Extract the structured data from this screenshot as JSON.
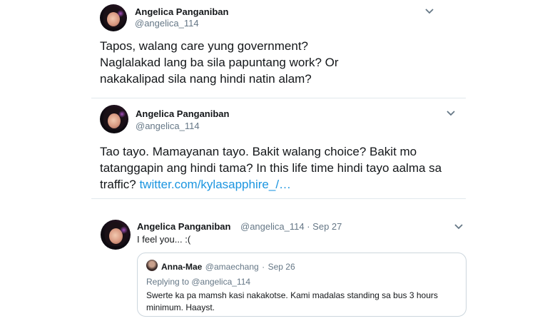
{
  "tweet1": {
    "name": "Angelica Panganiban",
    "handle": "@angelica_114",
    "text": "Tapos, walang care yung government? Naglalakad lang ba sila papuntang work? Or nakakalipad sila nang hindi natin alam?",
    "menu_icon": "chevron-down-icon"
  },
  "tweet2": {
    "name": "Angelica Panganiban",
    "handle": "@angelica_114",
    "text": "Tao tayo. Mamayanan tayo. Bakit walang choice? Bakit mo tatanggapin ang hindi tama? In this life time hindi tayo aalma sa traffic?",
    "link": "twitter.com/kylasapphire_/…",
    "menu_icon": "chevron-down-icon"
  },
  "tweet3": {
    "name": "Angelica Panganiban",
    "handle": "@angelica_114",
    "dot": "·",
    "date": "Sep 27",
    "text": "I feel you... :(",
    "menu_icon": "chevron-down-icon",
    "quote": {
      "name": "Anna-Mae",
      "handle": "@amaechang",
      "dot": "·",
      "date": "Sep 26",
      "replying_to": "Replying to @angelica_114",
      "text": "Swerte ka pa mamsh kasi nakakotse. Kami madalas standing sa bus 3 hours minimum. Haayst."
    }
  },
  "colors": {
    "text": "#14171a",
    "muted": "#657786",
    "link": "#1b95e0",
    "border": "#e1e8ed"
  }
}
